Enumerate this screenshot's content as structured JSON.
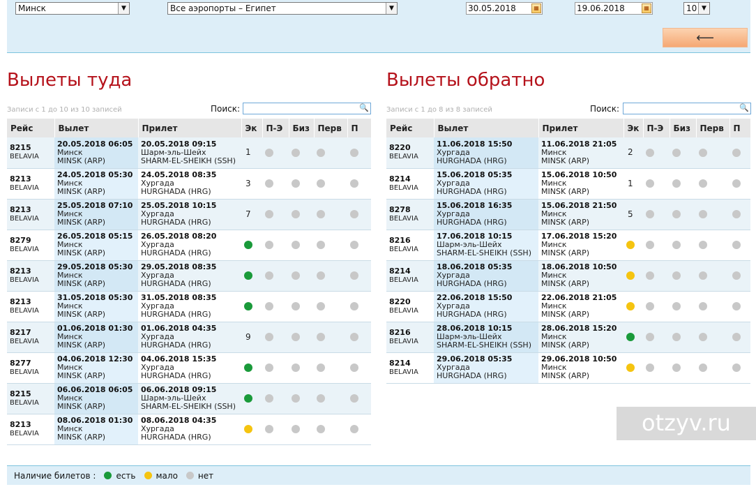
{
  "filters": {
    "from_city": "Минск",
    "to_airports": "Все аэропорты – Египет",
    "date_out": "30.05.2018",
    "date_back": "19.06.2018",
    "page_size": "10",
    "back_icon": "return-arrow-icon"
  },
  "outbound": {
    "title": "Вылеты туда",
    "info": "Записи с 1 до 10 из 10 записей",
    "search_label": "Поиск:",
    "search_value": "",
    "columns": [
      "Рейс",
      "Вылет",
      "Прилет",
      "Эк",
      "П-Э",
      "Биз",
      "Перв",
      "П"
    ],
    "rows": [
      {
        "flight": "8215",
        "airline": "BELAVIA",
        "dep_dt": "20.05.2018 06:05",
        "dep_city": "Минск",
        "dep_code": "MINSK (ARP)",
        "arr_dt": "20.05.2018 09:15",
        "arr_city": "Шарм-эль-Шейх",
        "arr_code": "SHARM-EL-SHEIKH (SSH)",
        "eco": "1",
        "eco_status": "grey"
      },
      {
        "flight": "8213",
        "airline": "BELAVIA",
        "dep_dt": "24.05.2018 05:30",
        "dep_city": "Минск",
        "dep_code": "MINSK (ARP)",
        "arr_dt": "24.05.2018 08:35",
        "arr_city": "Хургада",
        "arr_code": "HURGHADA (HRG)",
        "eco": "3",
        "eco_status": "grey"
      },
      {
        "flight": "8213",
        "airline": "BELAVIA",
        "dep_dt": "25.05.2018 07:10",
        "dep_city": "Минск",
        "dep_code": "MINSK (ARP)",
        "arr_dt": "25.05.2018 10:15",
        "arr_city": "Хургада",
        "arr_code": "HURGHADA (HRG)",
        "eco": "7",
        "eco_status": "grey"
      },
      {
        "flight": "8279",
        "airline": "BELAVIA",
        "dep_dt": "26.05.2018 05:15",
        "dep_city": "Минск",
        "dep_code": "MINSK (ARP)",
        "arr_dt": "26.05.2018 08:20",
        "arr_city": "Хургада",
        "arr_code": "HURGHADA (HRG)",
        "eco": "",
        "eco_status": "green"
      },
      {
        "flight": "8213",
        "airline": "BELAVIA",
        "dep_dt": "29.05.2018 05:30",
        "dep_city": "Минск",
        "dep_code": "MINSK (ARP)",
        "arr_dt": "29.05.2018 08:35",
        "arr_city": "Хургада",
        "arr_code": "HURGHADA (HRG)",
        "eco": "",
        "eco_status": "green"
      },
      {
        "flight": "8213",
        "airline": "BELAVIA",
        "dep_dt": "31.05.2018 05:30",
        "dep_city": "Минск",
        "dep_code": "MINSK (ARP)",
        "arr_dt": "31.05.2018 08:35",
        "arr_city": "Хургада",
        "arr_code": "HURGHADA (HRG)",
        "eco": "",
        "eco_status": "green"
      },
      {
        "flight": "8217",
        "airline": "BELAVIA",
        "dep_dt": "01.06.2018 01:30",
        "dep_city": "Минск",
        "dep_code": "MINSK (ARP)",
        "arr_dt": "01.06.2018 04:35",
        "arr_city": "Хургада",
        "arr_code": "HURGHADA (HRG)",
        "eco": "9",
        "eco_status": "grey"
      },
      {
        "flight": "8277",
        "airline": "BELAVIA",
        "dep_dt": "04.06.2018 12:30",
        "dep_city": "Минск",
        "dep_code": "MINSK (ARP)",
        "arr_dt": "04.06.2018 15:35",
        "arr_city": "Хургада",
        "arr_code": "HURGHADA (HRG)",
        "eco": "",
        "eco_status": "green"
      },
      {
        "flight": "8215",
        "airline": "BELAVIA",
        "dep_dt": "06.06.2018 06:05",
        "dep_city": "Минск",
        "dep_code": "MINSK (ARP)",
        "arr_dt": "06.06.2018 09:15",
        "arr_city": "Шарм-эль-Шейх",
        "arr_code": "SHARM-EL-SHEIKH (SSH)",
        "eco": "",
        "eco_status": "green"
      },
      {
        "flight": "8213",
        "airline": "BELAVIA",
        "dep_dt": "08.06.2018 01:30",
        "dep_city": "Минск",
        "dep_code": "MINSK (ARP)",
        "arr_dt": "08.06.2018 04:35",
        "arr_city": "Хургада",
        "arr_code": "HURGHADA (HRG)",
        "eco": "",
        "eco_status": "yellow"
      }
    ]
  },
  "inbound": {
    "title": "Вылеты обратно",
    "info": "Записи с 1 до 8 из 8 записей",
    "search_label": "Поиск:",
    "search_value": "",
    "columns": [
      "Рейс",
      "Вылет",
      "Прилет",
      "Эк",
      "П-Э",
      "Биз",
      "Перв",
      "П"
    ],
    "rows": [
      {
        "flight": "8220",
        "airline": "BELAVIA",
        "dep_dt": "11.06.2018 15:50",
        "dep_city": "Хургада",
        "dep_code": "HURGHADA (HRG)",
        "arr_dt": "11.06.2018 21:05",
        "arr_city": "Минск",
        "arr_code": "MINSK (ARP)",
        "eco": "2",
        "eco_status": "grey"
      },
      {
        "flight": "8214",
        "airline": "BELAVIA",
        "dep_dt": "15.06.2018 05:35",
        "dep_city": "Хургада",
        "dep_code": "HURGHADA (HRG)",
        "arr_dt": "15.06.2018 10:50",
        "arr_city": "Минск",
        "arr_code": "MINSK (ARP)",
        "eco": "1",
        "eco_status": "grey"
      },
      {
        "flight": "8278",
        "airline": "BELAVIA",
        "dep_dt": "15.06.2018 16:35",
        "dep_city": "Хургада",
        "dep_code": "HURGHADA (HRG)",
        "arr_dt": "15.06.2018 21:50",
        "arr_city": "Минск",
        "arr_code": "MINSK (ARP)",
        "eco": "5",
        "eco_status": "grey"
      },
      {
        "flight": "8216",
        "airline": "BELAVIA",
        "dep_dt": "17.06.2018 10:15",
        "dep_city": "Шарм-эль-Шейх",
        "dep_code": "SHARM-EL-SHEIKH (SSH)",
        "arr_dt": "17.06.2018 15:20",
        "arr_city": "Минск",
        "arr_code": "MINSK (ARP)",
        "eco": "",
        "eco_status": "yellow"
      },
      {
        "flight": "8214",
        "airline": "BELAVIA",
        "dep_dt": "18.06.2018 05:35",
        "dep_city": "Хургада",
        "dep_code": "HURGHADA (HRG)",
        "arr_dt": "18.06.2018 10:50",
        "arr_city": "Минск",
        "arr_code": "MINSK (ARP)",
        "eco": "",
        "eco_status": "yellow"
      },
      {
        "flight": "8220",
        "airline": "BELAVIA",
        "dep_dt": "22.06.2018 15:50",
        "dep_city": "Хургада",
        "dep_code": "HURGHADA (HRG)",
        "arr_dt": "22.06.2018 21:05",
        "arr_city": "Минск",
        "arr_code": "MINSK (ARP)",
        "eco": "",
        "eco_status": "yellow"
      },
      {
        "flight": "8216",
        "airline": "BELAVIA",
        "dep_dt": "28.06.2018 10:15",
        "dep_city": "Шарм-эль-Шейх",
        "dep_code": "SHARM-EL-SHEIKH (SSH)",
        "arr_dt": "28.06.2018 15:20",
        "arr_city": "Минск",
        "arr_code": "MINSK (ARP)",
        "eco": "",
        "eco_status": "green"
      },
      {
        "flight": "8214",
        "airline": "BELAVIA",
        "dep_dt": "29.06.2018 05:35",
        "dep_city": "Хургада",
        "dep_code": "HURGHADA (HRG)",
        "arr_dt": "29.06.2018 10:50",
        "arr_city": "Минск",
        "arr_code": "MINSK (ARP)",
        "eco": "",
        "eco_status": "yellow"
      }
    ]
  },
  "legend": {
    "label": "Наличие билетов :",
    "items": [
      {
        "label": "есть",
        "status": "green"
      },
      {
        "label": "мало",
        "status": "yellow"
      },
      {
        "label": "нет",
        "status": "grey"
      }
    ]
  },
  "colors": {
    "title": "#b5121b",
    "green": "#1a9a3a",
    "yellow": "#f5c410",
    "grey": "#c8c8c8",
    "panel": "#ddeef8"
  },
  "watermark": "otzyv.ru"
}
